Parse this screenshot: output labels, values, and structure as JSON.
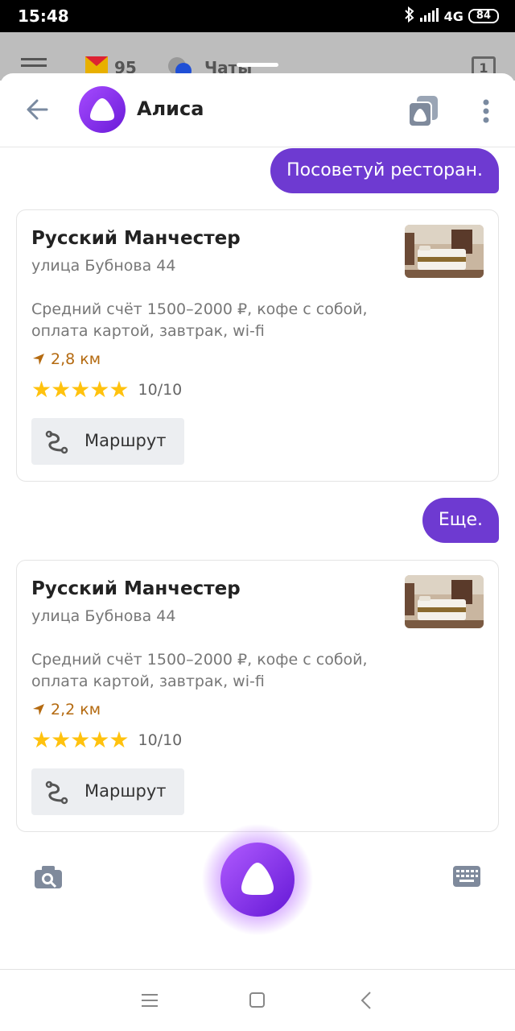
{
  "status_bar": {
    "time": "15:48",
    "network": "4G",
    "battery": "84"
  },
  "background_app": {
    "mail_count": "95",
    "chats_label": "Чаты",
    "badge": "1"
  },
  "header": {
    "title": "Алиса"
  },
  "messages": [
    {
      "type": "user",
      "text": "Посоветуй ресторан."
    },
    {
      "type": "card",
      "title": "Русский Манчестер",
      "address": "улица Бубнова 44",
      "description": "Средний счёт 1500–2000 ₽, кофе с собой, оплата картой, завтрак, wi-fi",
      "distance": "2,8 км",
      "stars": "★★★★★",
      "rating": "10/10",
      "button_label": "Маршрут"
    },
    {
      "type": "user",
      "text": "Еще."
    },
    {
      "type": "card",
      "title": "Русский Манчестер",
      "address": "улица Бубнова 44",
      "description": "Средний счёт 1500–2000 ₽, кофе с собой, оплата картой, завтрак, wi-fi",
      "distance": "2,2 км",
      "stars": "★★★★★",
      "rating": "10/10",
      "button_label": "Маршрут"
    }
  ],
  "colors": {
    "accent": "#6e3ad1",
    "star": "#ffc20e",
    "distance": "#b46a10"
  },
  "icons": {
    "back": "arrow-left-icon",
    "skills": "skills-icon",
    "more": "more-vertical-icon",
    "camera": "camera-search-icon",
    "keyboard": "keyboard-icon",
    "route": "route-icon",
    "navigation": "navigation-arrow-icon"
  }
}
